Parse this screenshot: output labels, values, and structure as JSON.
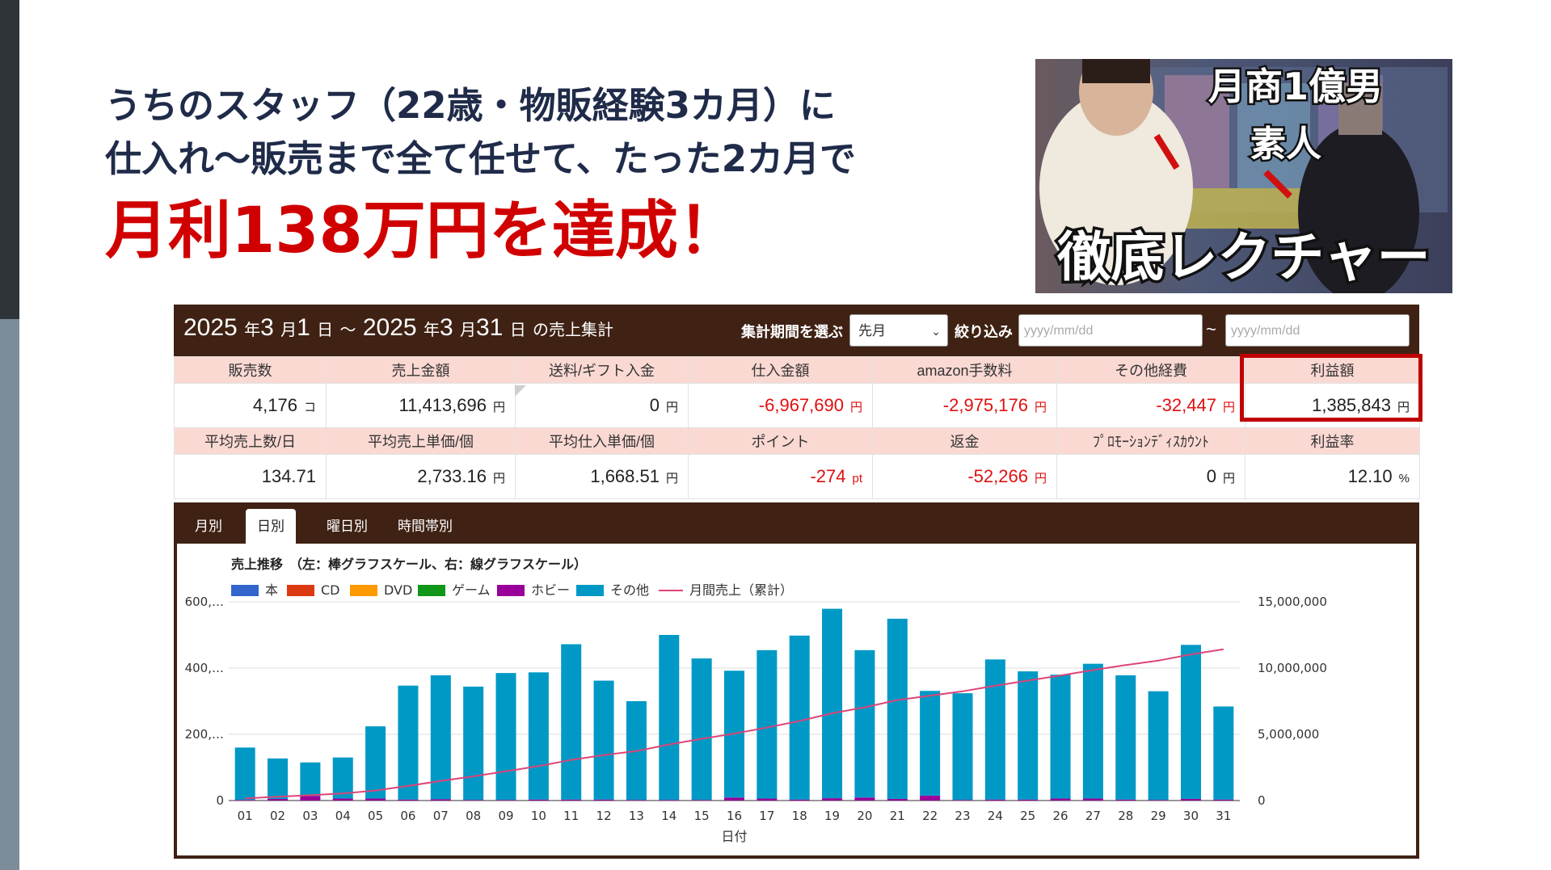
{
  "headline": {
    "line1": "うちのスタッフ（22歳・物販経験3カ月）に",
    "line2": "仕入れ〜販売まで全て任せて、たった2カ月で",
    "line3": "月利138万円を達成！"
  },
  "thumbnail": {
    "caption_top": "月商1億男",
    "caption_mid": "素人",
    "caption_bottom": "徹底レクチャー"
  },
  "header": {
    "y1": "2025",
    "u_year1": "年",
    "m1": "3",
    "u_month1": "月",
    "d1": "1",
    "u_day1": "日",
    "tilde": "～",
    "y2": "2025",
    "u_year2": "年",
    "m2": "3",
    "u_month2": "月",
    "d2": "31",
    "u_day2": "日",
    "suffix": "の売上集計",
    "period_label": "集計期間を選ぶ",
    "period_value": "先月",
    "filter_label": "絞り込み",
    "date_placeholder": "yyyy/mm/dd",
    "range_sep": "~"
  },
  "stats_row1_headers": [
    "販売数",
    "売上金額",
    "送料/ギフト入金",
    "仕入金額",
    "amazon手数料",
    "その他経費",
    "利益額"
  ],
  "stats_row1_values": [
    {
      "v": "4,176",
      "u": "コ",
      "neg": false
    },
    {
      "v": "11,413,696",
      "u": "円",
      "neg": false
    },
    {
      "v": "0",
      "u": "円",
      "neg": false
    },
    {
      "v": "-6,967,690",
      "u": "円",
      "neg": true
    },
    {
      "v": "-2,975,176",
      "u": "円",
      "neg": true
    },
    {
      "v": "-32,447",
      "u": "円",
      "neg": true
    },
    {
      "v": "1,385,843",
      "u": "円",
      "neg": false
    }
  ],
  "stats_row2_headers": [
    "平均売上数/日",
    "平均売上単価/個",
    "平均仕入単価/個",
    "ポイント",
    "返金",
    "ﾌﾟﾛﾓｰｼｮﾝﾃﾞｨｽｶｳﾝﾄ",
    "利益率"
  ],
  "stats_row2_values": [
    {
      "v": "134.71",
      "u": "",
      "neg": false
    },
    {
      "v": "2,733.16",
      "u": "円",
      "neg": false
    },
    {
      "v": "1,668.51",
      "u": "円",
      "neg": false
    },
    {
      "v": "-274",
      "u": "pt",
      "neg": true
    },
    {
      "v": "-52,266",
      "u": "円",
      "neg": true
    },
    {
      "v": "0",
      "u": "円",
      "neg": false
    },
    {
      "v": "12.10",
      "u": "%",
      "neg": false
    }
  ],
  "tabs": [
    "月別",
    "日別",
    "曜日別",
    "時間帯別"
  ],
  "active_tab": "日別",
  "chart_data": {
    "type": "bar",
    "title": "売上推移　（左：棒グラフスケール、右：線グラフスケール）",
    "xlabel": "日付",
    "categories": [
      "01",
      "02",
      "03",
      "04",
      "05",
      "06",
      "07",
      "08",
      "09",
      "10",
      "11",
      "12",
      "13",
      "14",
      "15",
      "16",
      "17",
      "18",
      "19",
      "20",
      "21",
      "22",
      "23",
      "24",
      "25",
      "26",
      "27",
      "28",
      "29",
      "30",
      "31"
    ],
    "legend": [
      {
        "name": "本",
        "color": "#3366cc"
      },
      {
        "name": "CD",
        "color": "#dc3912"
      },
      {
        "name": "DVD",
        "color": "#ff9900"
      },
      {
        "name": "ゲーム",
        "color": "#109618"
      },
      {
        "name": "ホビー",
        "color": "#990099"
      },
      {
        "name": "その他",
        "color": "#0099c6"
      },
      {
        "name": "月間売上（累計）",
        "color": "#dd4477",
        "line": true
      }
    ],
    "left_axis": {
      "ticks": [
        "0",
        "200,…",
        "400,…",
        "600,…"
      ],
      "max": 600000
    },
    "right_axis": {
      "ticks": [
        "0",
        "5,000,000",
        "10,000,000",
        "15,000,000"
      ],
      "max": 15000000
    },
    "series": [
      {
        "name": "ホビー",
        "values": [
          2000,
          5000,
          14000,
          6000,
          6000,
          3000,
          4000,
          2000,
          2000,
          3000,
          3000,
          3000,
          2000,
          2000,
          2000,
          9000,
          6000,
          3000,
          7000,
          9000,
          5000,
          15000,
          2000,
          3000,
          3000,
          6000,
          6000,
          3000,
          2000,
          5000,
          3000
        ]
      },
      {
        "name": "その他",
        "values": [
          158000,
          122000,
          101000,
          124000,
          218000,
          344000,
          374000,
          342000,
          383000,
          384000,
          469000,
          359000,
          298000,
          498000,
          427000,
          383000,
          448000,
          495000,
          572000,
          445000,
          544000,
          316000,
          322000,
          423000,
          387000,
          374000,
          407000,
          375000,
          328000,
          465000,
          281000
        ]
      },
      {
        "name": "月間売上（累計）",
        "values": [
          160000,
          287000,
          402000,
          532000,
          756000,
          1103000,
          1481000,
          1825000,
          2210000,
          2597000,
          3069000,
          3431000,
          3731000,
          4231000,
          4660000,
          5052000,
          5506000,
          6004000,
          6583000,
          7037000,
          7586000,
          7917000,
          8241000,
          8667000,
          9057000,
          9437000,
          9850000,
          10228000,
          10558000,
          11028000,
          11414000
        ]
      }
    ]
  }
}
